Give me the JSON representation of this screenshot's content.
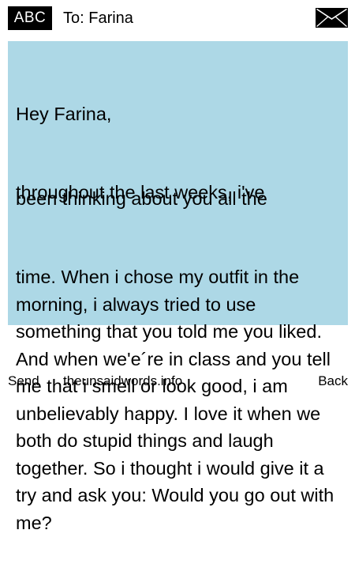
{
  "header": {
    "input_mode": "ABC",
    "recipient_label": "To: Farina",
    "icon": "envelope-icon"
  },
  "message": {
    "greeting": "Hey Farina,",
    "overlap_line_a": "throughout the last weeks, i've",
    "overlap_line_b": "been thinking about you all the",
    "body": "time. When i chose my outfit in the morning, i always tried to use something that you told me you liked. And when we'e´re in class and you tell me that i smell or look good, i am unbelievably happy. I love it when we both do stupid things and laugh together. So i thought i would give it a try and ask you: Would you go out with me?"
  },
  "softkeys": {
    "left": "Send",
    "center": "theunsaidwords.info",
    "right": "Back"
  },
  "colors": {
    "message_background": "#add8e6",
    "badge_background": "#000000"
  }
}
